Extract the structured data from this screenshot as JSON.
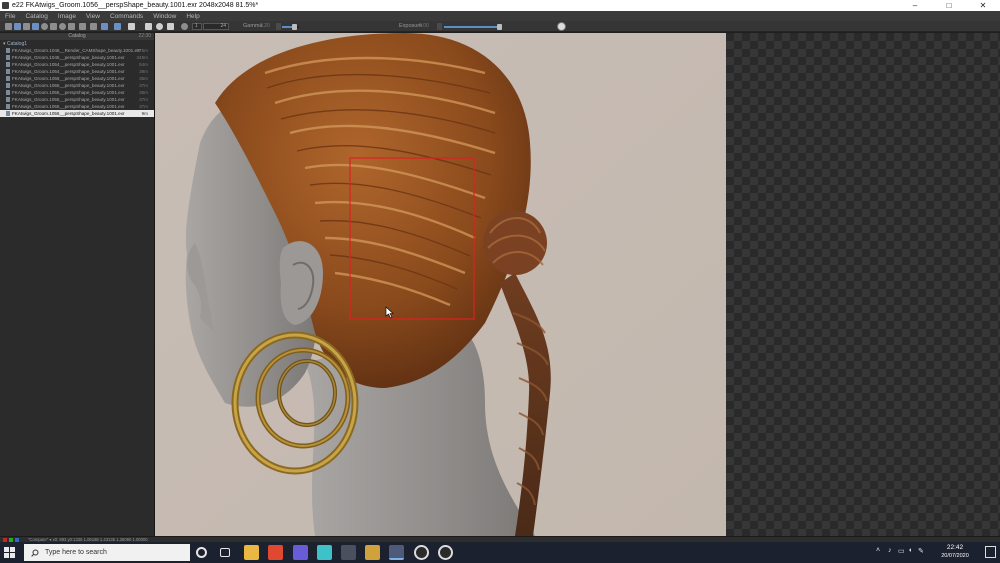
{
  "window": {
    "title": "e22 FKAtwigs_Groom.1056__perspShape_beauty.1001.exr 2048x2048 81.5%*",
    "controls": [
      "–",
      "□",
      "✕"
    ]
  },
  "menu": [
    "File",
    "Catalog",
    "Image",
    "View",
    "Commands",
    "Window",
    "Help"
  ],
  "toolbar": {
    "frame_start": "1",
    "frame_end": "24",
    "gamma_label": "Gamma",
    "gamma_value": "2.20",
    "exposure_label": "Exposure",
    "exposure_value": "0.00"
  },
  "catalog": {
    "header": "Catalog",
    "header_right": "22:30",
    "root": "Catalog1",
    "items": [
      {
        "name": "FKAtwigs_Groom.1046__Render_CAMShape_beauty.1001.exr",
        "size": "775m"
      },
      {
        "name": "FKAtwigs_Groom.1045__perspShape_beauty.1001.exr",
        "size": "345m"
      },
      {
        "name": "FKAtwigs_Groom.1054__perspShape_beauty.1001.exr",
        "size": "54m"
      },
      {
        "name": "FKAtwigs_Groom.1054__perspShape_beauty.1001.exr",
        "size": "39m"
      },
      {
        "name": "FKAtwigs_Groom.1056__perspShape_beauty.1001.exr",
        "size": "35m"
      },
      {
        "name": "FKAtwigs_Groom.1055__perspShape_beauty.1001.exr",
        "size": "37m"
      },
      {
        "name": "FKAtwigs_Groom.1055__perspShape_beauty.1001.exr",
        "size": "35m"
      },
      {
        "name": "FKAtwigs_Groom.1055__perspShape_beauty.1001.exr",
        "size": "37m"
      },
      {
        "name": "FKAtwigs_Groom.1055__perspShape_beauty.1001.exr",
        "size": "37m"
      },
      {
        "name": "FKAtwigs_Groom.1056__perspShape_beauty.1001.exr",
        "size": "9m"
      }
    ],
    "selected_index": 9
  },
  "statusbar": {
    "text": "\"Compare\" ▾   x0: 893    y0:1335    1.06188  1.43135  1.35090  1.00000"
  },
  "taskbar": {
    "search_placeholder": "Type here to search",
    "time": "22:42",
    "date": "20/07/2020",
    "apps": [
      {
        "icon": "cortana-icon",
        "color": "#1c2130"
      },
      {
        "icon": "task-view-icon",
        "color": "#1c2130"
      },
      {
        "icon": "file-explorer-icon",
        "color": "#e8b842"
      },
      {
        "icon": "chrome-icon",
        "color": "#e0492f"
      },
      {
        "icon": "unity-hub-icon",
        "color": "#6a5bd8"
      },
      {
        "icon": "maya-icon",
        "color": "#3ec1c8"
      },
      {
        "icon": "aftereffects-icon",
        "color": "#4a5060"
      },
      {
        "icon": "substance-icon",
        "color": "#d1a23c"
      },
      {
        "icon": "djv-viewer-icon",
        "color": "#4e5a7a"
      },
      {
        "icon": "obs-icon",
        "color": "#2a2a2a"
      },
      {
        "icon": "steam-icon",
        "color": "#2a2a2a"
      }
    ]
  }
}
